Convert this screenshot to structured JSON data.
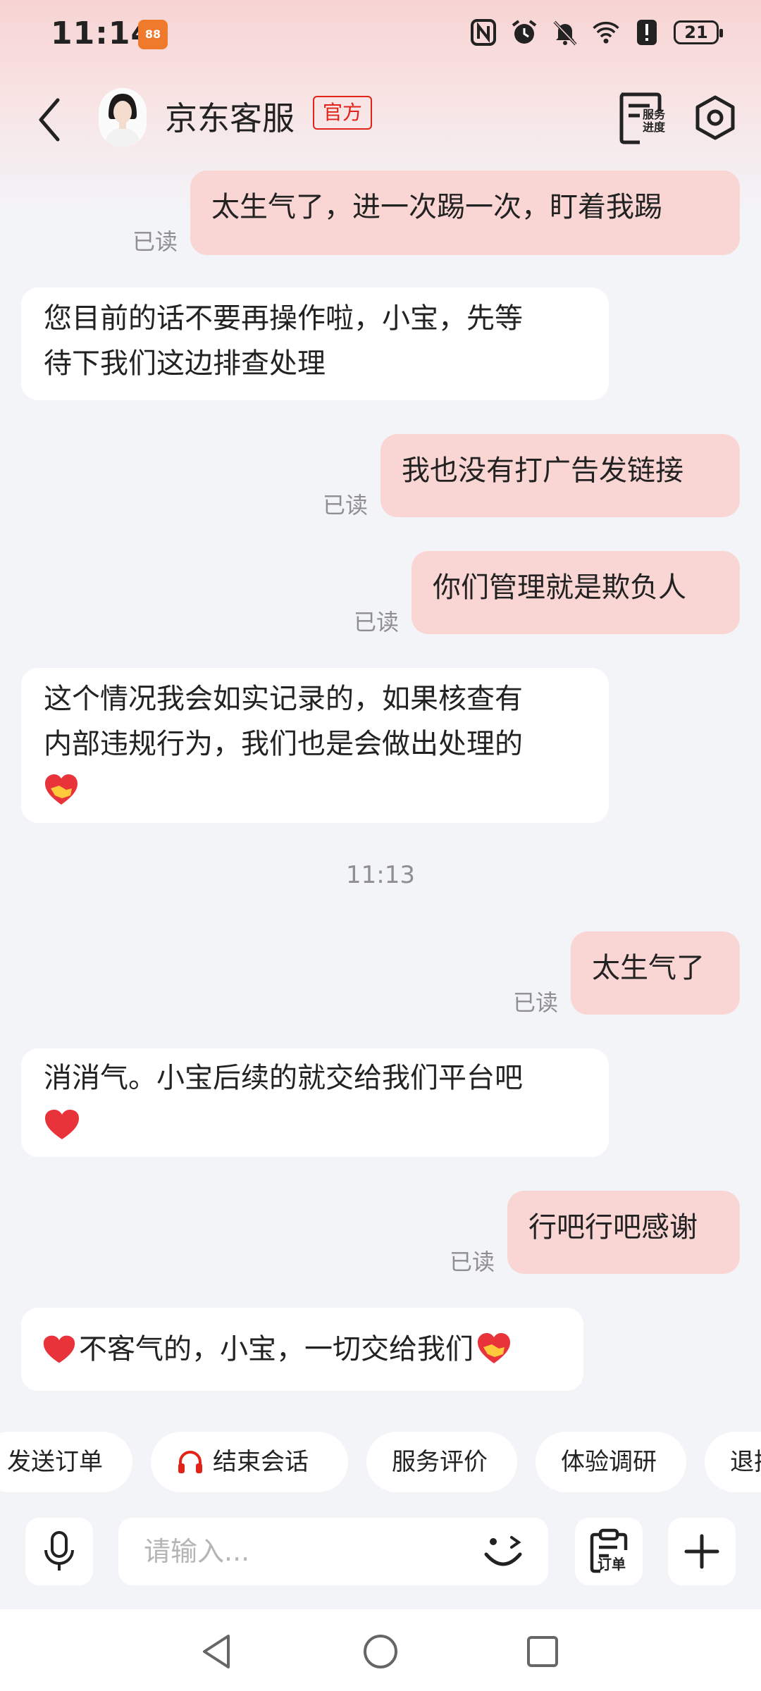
{
  "status_bar": {
    "time": "11:14",
    "app_icon_text": "88",
    "battery": "21",
    "icons": [
      "nfc-icon",
      "alarm-icon",
      "mute-icon",
      "wifi-icon",
      "alert-icon",
      "battery-icon"
    ]
  },
  "header": {
    "title": "京东客服",
    "badge": "官方",
    "service_progress_label": "服务进度"
  },
  "messages": [
    {
      "side": "right",
      "text": "太生气了，进一次踢一次，盯着我踢",
      "read": "已读"
    },
    {
      "side": "left",
      "line1": "您目前的话不要再操作啦，小宝，先等",
      "line2": "待下我们这边排查处理"
    },
    {
      "side": "right",
      "text": "我也没有打广告发链接",
      "read": "已读"
    },
    {
      "side": "right",
      "text": "你们管理就是欺负人",
      "read": "已读"
    },
    {
      "side": "left",
      "line1": "这个情况我会如实记录的，如果核查有",
      "line2": "内部违规行为，我们也是会做出处理的",
      "emoji": "🤝"
    },
    {
      "side": "right",
      "text": "太生气了",
      "read": "已读"
    },
    {
      "side": "left",
      "line1": "消消气。小宝后续的就交给我们平台吧",
      "emoji": "❤"
    },
    {
      "side": "right",
      "text": "行吧行吧感谢",
      "read": "已读"
    },
    {
      "side": "left",
      "line1": "不客气的，小宝，一切交给我们",
      "emoji_before": "❤",
      "emoji_after": "🤝"
    }
  ],
  "time_separator": "11:13",
  "quick_actions": [
    "发送订单",
    "结束会话",
    "服务评价",
    "体验调研",
    "退换"
  ],
  "input": {
    "placeholder": "请输入...",
    "order_label": "订单"
  },
  "colors": {
    "accent": "#e2231a",
    "bubble_right": "#f9d6d3",
    "bubble_left": "#ffffff",
    "background": "#f3f4f8"
  }
}
